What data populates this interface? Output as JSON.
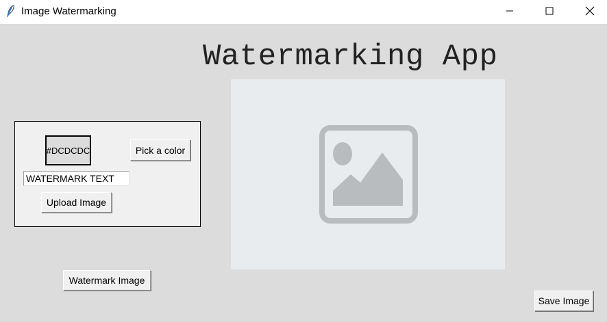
{
  "window": {
    "title": "Image Watermarking",
    "app_icon": "feather-icon",
    "controls": [
      "minimize-icon",
      "maximize-icon",
      "close-icon"
    ]
  },
  "heading": "Watermarking App",
  "image_area": {
    "icon": "image-placeholder-icon",
    "background": "#e8ecef",
    "icon_color": "#b8bcbf"
  },
  "panel": {
    "color_swatch": {
      "label": "#DCDCDC",
      "color": "#DCDCDC"
    },
    "pick_color_label": "Pick a color",
    "watermark_text_value": "WATERMARK TEXT",
    "upload_label": "Upload Image"
  },
  "watermark_button_label": "Watermark Image",
  "save_button_label": "Save Image"
}
